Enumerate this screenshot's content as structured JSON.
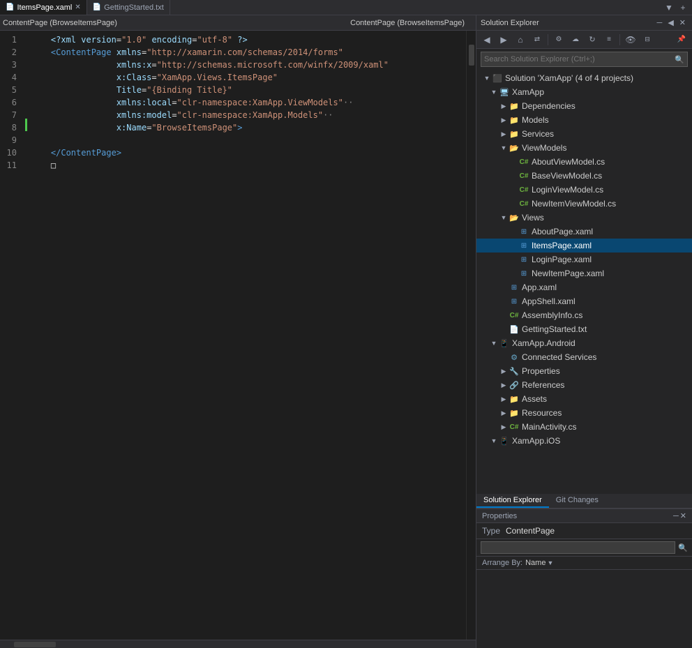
{
  "tabs": [
    {
      "id": "itemspage-xaml",
      "label": "ItemsPage.xaml",
      "active": true,
      "closable": true
    },
    {
      "id": "gettingstarted-txt",
      "label": "GettingStarted.txt",
      "active": false,
      "closable": false
    }
  ],
  "editor": {
    "breadcrumb_left": "ContentPage (BrowseItemsPage)",
    "breadcrumb_right": "ContentPage (BrowseItemsPage)",
    "lines": [
      {
        "num": 1,
        "content": "    <?xml version=\"1.0\" encoding=\"utf-8\" ?>"
      },
      {
        "num": 2,
        "content": "    <ContentPage xmlns=\"http://xamarin.com/schemas/2014/forms\""
      },
      {
        "num": 3,
        "content": "                 xmlns:x=\"http://schemas.microsoft.com/winfx/2009/xaml\""
      },
      {
        "num": 4,
        "content": "                 x:Class=\"XamApp.Views.ItemsPage\""
      },
      {
        "num": 5,
        "content": "                 Title=\"{Binding Title}\""
      },
      {
        "num": 6,
        "content": "                 xmlns:local=\"clr-namespace:XamApp.ViewModels\""
      },
      {
        "num": 7,
        "content": "                 xmlns:model=\"clr-namespace:XamApp.Models\""
      },
      {
        "num": 8,
        "content": "                 x:Name=\"BrowseItemsPage\">"
      },
      {
        "num": 9,
        "content": ""
      },
      {
        "num": 10,
        "content": "    </ContentPage>"
      },
      {
        "num": 11,
        "content": "    □"
      }
    ]
  },
  "solution_explorer": {
    "title": "Solution Explorer",
    "search_placeholder": "Search Solution Explorer (Ctrl+;)",
    "solution_label": "Solution 'XamApp' (4 of 4 projects)",
    "toolbar_buttons": [
      "back",
      "forward",
      "home",
      "sync",
      "more1",
      "more2",
      "refresh",
      "more3",
      "more4",
      "collapse"
    ],
    "tree": [
      {
        "id": "solution",
        "label": "Solution 'XamApp' (4 of 4 projects)",
        "indent": 0,
        "expanded": true,
        "icon": "solution"
      },
      {
        "id": "xamapp",
        "label": "XamApp",
        "indent": 1,
        "expanded": true,
        "icon": "project"
      },
      {
        "id": "dependencies",
        "label": "Dependencies",
        "indent": 2,
        "expanded": false,
        "icon": "folder"
      },
      {
        "id": "models",
        "label": "Models",
        "indent": 2,
        "expanded": false,
        "icon": "folder"
      },
      {
        "id": "services",
        "label": "Services",
        "indent": 2,
        "expanded": false,
        "icon": "folder"
      },
      {
        "id": "viewmodels",
        "label": "ViewModels",
        "indent": 2,
        "expanded": true,
        "icon": "folder"
      },
      {
        "id": "aboutviewmodel",
        "label": "AboutViewModel.cs",
        "indent": 3,
        "expanded": false,
        "icon": "cs"
      },
      {
        "id": "baseviewmodel",
        "label": "BaseViewModel.cs",
        "indent": 3,
        "expanded": false,
        "icon": "cs"
      },
      {
        "id": "loginviewmodel",
        "label": "LoginViewModel.cs",
        "indent": 3,
        "expanded": false,
        "icon": "cs"
      },
      {
        "id": "newitemviewmodel",
        "label": "NewItemViewModel.cs",
        "indent": 3,
        "expanded": false,
        "icon": "cs"
      },
      {
        "id": "views",
        "label": "Views",
        "indent": 2,
        "expanded": true,
        "icon": "folder"
      },
      {
        "id": "aboutpage",
        "label": "AboutPage.xaml",
        "indent": 3,
        "expanded": false,
        "icon": "xaml"
      },
      {
        "id": "itemspage",
        "label": "ItemsPage.xaml",
        "indent": 3,
        "expanded": false,
        "icon": "xaml",
        "selected": true
      },
      {
        "id": "loginpage",
        "label": "LoginPage.xaml",
        "indent": 3,
        "expanded": false,
        "icon": "xaml"
      },
      {
        "id": "newitempage",
        "label": "NewItemPage.xaml",
        "indent": 3,
        "expanded": false,
        "icon": "xaml"
      },
      {
        "id": "appxaml",
        "label": "App.xaml",
        "indent": 2,
        "expanded": false,
        "icon": "xaml"
      },
      {
        "id": "appshell",
        "label": "AppShell.xaml",
        "indent": 2,
        "expanded": false,
        "icon": "xaml"
      },
      {
        "id": "assemblyinfo",
        "label": "AssemblyInfo.cs",
        "indent": 2,
        "expanded": false,
        "icon": "cs"
      },
      {
        "id": "gettingstarted",
        "label": "GettingStarted.txt",
        "indent": 2,
        "expanded": false,
        "icon": "txt"
      },
      {
        "id": "xamapp-android",
        "label": "XamApp.Android",
        "indent": 1,
        "expanded": true,
        "icon": "project"
      },
      {
        "id": "connected-services",
        "label": "Connected Services",
        "indent": 2,
        "expanded": false,
        "icon": "services"
      },
      {
        "id": "properties",
        "label": "Properties",
        "indent": 2,
        "expanded": false,
        "icon": "wrench"
      },
      {
        "id": "references",
        "label": "References",
        "indent": 2,
        "expanded": false,
        "icon": "references"
      },
      {
        "id": "assets",
        "label": "Assets",
        "indent": 2,
        "expanded": false,
        "icon": "folder"
      },
      {
        "id": "resources",
        "label": "Resources",
        "indent": 2,
        "expanded": false,
        "icon": "folder"
      },
      {
        "id": "mainactivity",
        "label": "MainActivity.cs",
        "indent": 2,
        "expanded": false,
        "icon": "cs"
      },
      {
        "id": "xamapp-ios",
        "label": "XamApp.iOS",
        "indent": 1,
        "expanded": false,
        "icon": "project"
      }
    ]
  },
  "properties": {
    "title": "Properties",
    "type_label": "Type",
    "type_value": "ContentPage",
    "search_placeholder": "",
    "arrange_label": "Arrange By:",
    "arrange_value": "Name"
  },
  "bottom_tabs": [
    {
      "label": "Solution Explorer",
      "active": true
    },
    {
      "label": "Git Changes",
      "active": false
    }
  ]
}
